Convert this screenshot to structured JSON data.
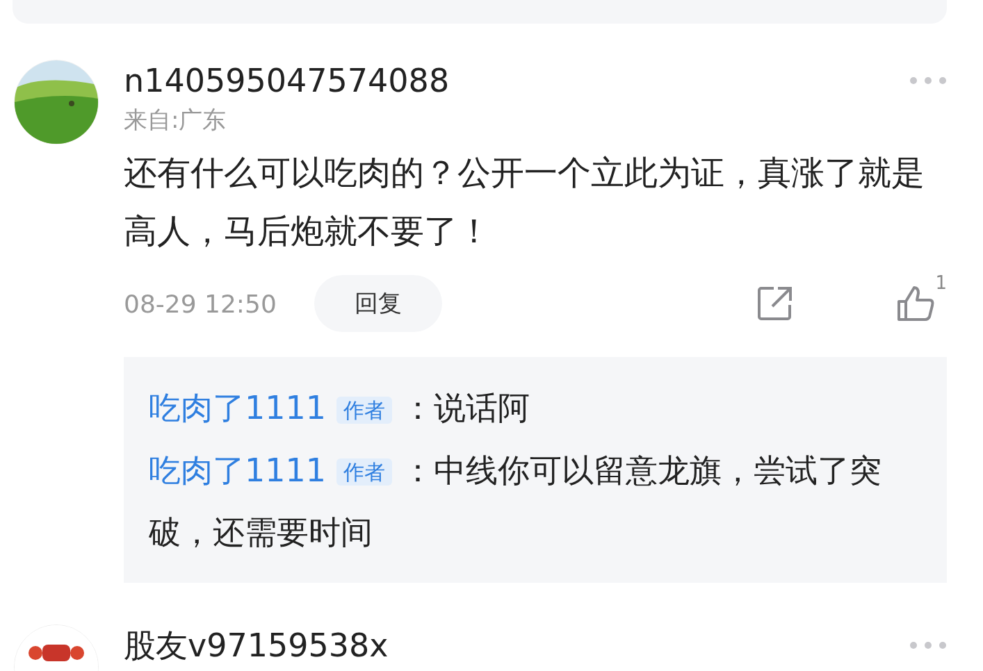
{
  "comments": [
    {
      "avatar": {
        "kind": "landscape"
      },
      "username": "n140595047574088",
      "location": "来自:广东",
      "text": "还有什么可以吃肉的？公开一个立此为证，真涨了就是高人，马后炮就不要了！",
      "time": "08-29 12:50",
      "reply_button": "回复",
      "like_count": "1",
      "replies": [
        {
          "author": "吃肉了1111",
          "badge": "作者",
          "text": "：说话阿"
        },
        {
          "author": "吃肉了1111",
          "badge": "作者",
          "text": "：中线你可以留意龙旗，尝试了突破，还需要时间"
        }
      ]
    },
    {
      "avatar": {
        "kind": "cartoon"
      },
      "username": "股友v97159538x"
    }
  ]
}
